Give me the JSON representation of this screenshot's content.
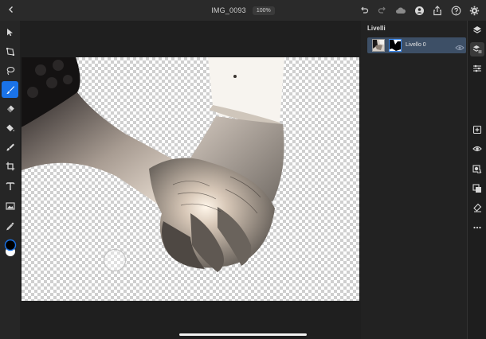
{
  "document": {
    "title": "IMG_0093",
    "zoom": "100%"
  },
  "layers_panel": {
    "title": "Livelli",
    "layers": [
      {
        "name": "Livello 0"
      }
    ]
  },
  "brush_palette": {
    "size": "27"
  },
  "colors": {
    "foreground": "#000000",
    "background": "#ffffff",
    "accent": "#1a73e8",
    "layer_selected": "#3d4f66"
  },
  "icons": {
    "top": [
      "back-icon",
      "undo-icon",
      "redo-icon",
      "cloud-icon",
      "account-icon",
      "share-icon",
      "help-icon",
      "settings-icon"
    ],
    "left_tools": [
      "select-icon",
      "transform-icon",
      "lasso-icon",
      "brush-icon",
      "eraser-icon",
      "fill-icon",
      "smudge-icon",
      "crop-icon",
      "type-icon",
      "image-icon",
      "eyedropper-icon"
    ],
    "right_rail": [
      "layers-icon",
      "layer-properties-icon",
      "adjustments-icon",
      "add-layer-icon",
      "visibility-icon",
      "mask-icon",
      "clipping-icon",
      "eraser-layer-icon",
      "more-icon"
    ]
  }
}
